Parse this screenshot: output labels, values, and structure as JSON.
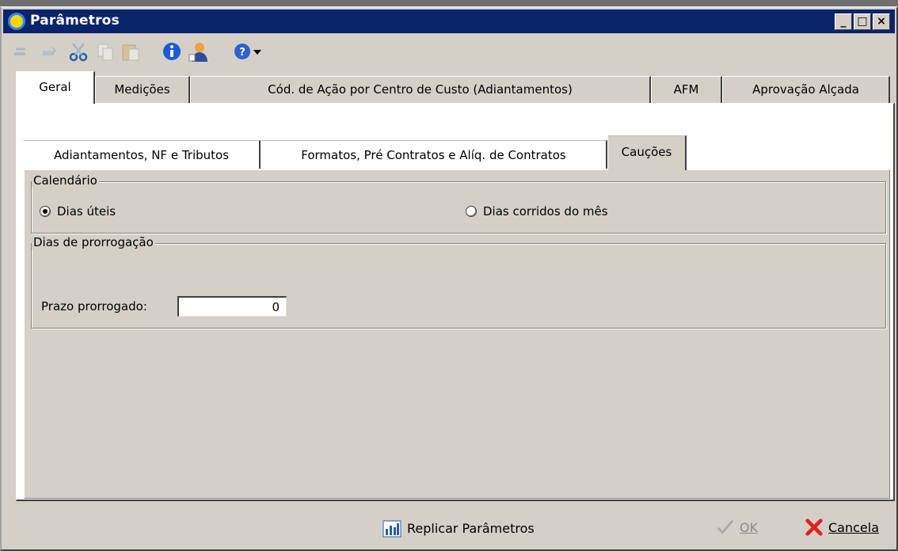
{
  "window": {
    "title": "Parâmetros"
  },
  "toolbar": {
    "icons": [
      "undo-icon",
      "redo-icon",
      "cut-icon",
      "copy-icon",
      "paste-icon",
      "info-icon",
      "user-icon",
      "help-icon",
      "dropdown-arrow-icon"
    ]
  },
  "tabs_main": [
    {
      "label": "Geral",
      "active": true
    },
    {
      "label": "Medições",
      "active": false
    },
    {
      "label": "Cód. de Ação por Centro de Custo (Adiantamentos)",
      "active": false
    },
    {
      "label": "AFM",
      "active": false
    },
    {
      "label": "Aprovação Alçada",
      "active": false
    }
  ],
  "tabs_sub": [
    {
      "label": "Adiantamentos, NF e Tributos",
      "active": false
    },
    {
      "label": "Formatos, Pré Contratos e Alíq. de Contratos",
      "active": false
    },
    {
      "label": "Cauções",
      "active": true
    }
  ],
  "calendar": {
    "legend": "Calendário",
    "options": [
      {
        "label": "Dias úteis",
        "selected": true
      },
      {
        "label": "Dias corridos do mês",
        "selected": false
      }
    ]
  },
  "extension": {
    "legend": "Dias de prorrogação",
    "field_label": "Prazo prorrogado:",
    "field_value": "0"
  },
  "buttons": {
    "replicate": "Replicar Parâmetros",
    "ok": "OK",
    "cancel": "Cancela"
  },
  "colors": {
    "titlebar": "#0a246a",
    "face": "#d4d0c8",
    "cancel_red": "#e02020"
  }
}
